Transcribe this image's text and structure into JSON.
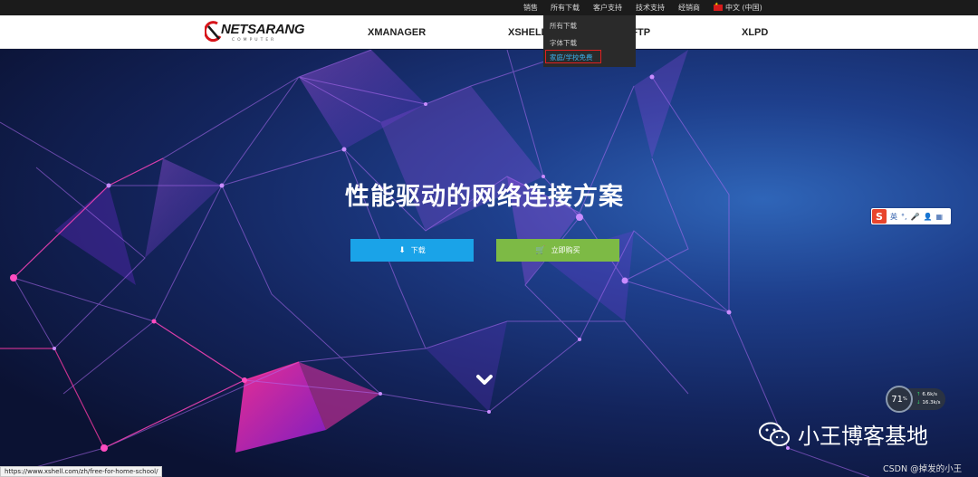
{
  "topbar": {
    "items": [
      "销售",
      "所有下载",
      "客户支持",
      "技术支持",
      "经销商"
    ],
    "language": "中文 (中国)"
  },
  "header": {
    "logo_text": "NETSARANG",
    "logo_subtext": "COMPUTER",
    "nav": [
      "XMANAGER",
      "XSHELL",
      "XFTP",
      "XLPD"
    ]
  },
  "dropdown": {
    "items": [
      "所有下载",
      "字体下载",
      "家庭/学校免费"
    ],
    "highlighted_index": 2
  },
  "hero": {
    "headline": "性能驱动的网络连接方案",
    "download_label": "下载",
    "buy_label": "立即购买"
  },
  "ime": {
    "lang": "英"
  },
  "network": {
    "percent": "71",
    "percent_unit": "%",
    "up": "6.6",
    "up_unit": "k/s",
    "down": "16.3",
    "down_unit": "k/s"
  },
  "watermark": {
    "text": "小王博客基地",
    "csdn": "CSDN @掉发的小王"
  },
  "status_url": "https://www.xshell.com/zh/free-for-home-school/",
  "colors": {
    "download": "#1aa3e8",
    "buy": "#7dba45",
    "highlight_border": "#e02020",
    "highlight_text": "#3ab3f0"
  }
}
